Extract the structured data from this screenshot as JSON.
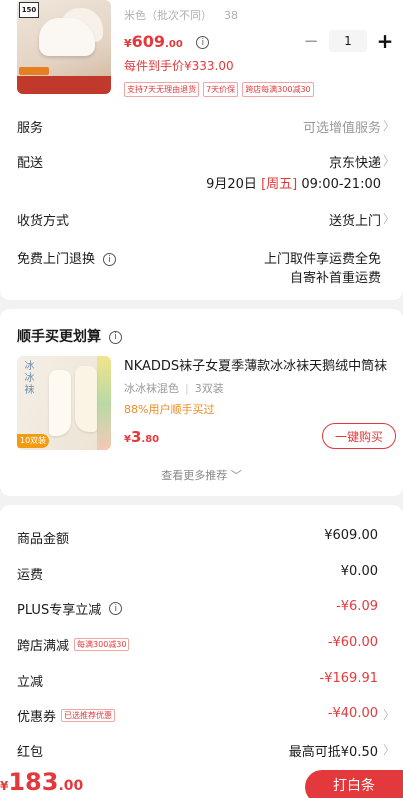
{
  "product": {
    "variant": "米色（批次不同）",
    "size": "38",
    "price_symbol": "¥",
    "price_int": "609",
    "price_dec": ".00",
    "per_piece": "每件到手价¥333.00",
    "quantity": "1",
    "tags": [
      "支持7天无理由退货",
      "7天价保",
      "跨店每满300减30"
    ],
    "thumb_badge": "150"
  },
  "service": {
    "label": "服务",
    "value": "可选增值服务"
  },
  "delivery": {
    "label": "配送",
    "carrier": "京东快递",
    "date": "9月20日",
    "weekday": "[周五]",
    "time": "09:00-21:00"
  },
  "receive": {
    "label": "收货方式",
    "value": "送货上门"
  },
  "return": {
    "label": "免费上门退换",
    "line1": "上门取件享运费全免",
    "line2": "自寄补首重运费"
  },
  "addon": {
    "title": "顺手买更划算",
    "product_title": "NKADDS袜子女夏季薄款冰冰袜天鹅绒中筒袜",
    "variant": "冰冰袜混色",
    "pack": "3双装",
    "rate": "88%用户顺手买过",
    "price_symbol": "¥",
    "price_int": "3",
    "price_dec": ".80",
    "buy_label": "一键购买",
    "more_label": "查看更多推荐",
    "thumb_text": "冰冰袜",
    "thumb_pill": "10双装"
  },
  "summary": {
    "rows": [
      {
        "label": "商品金额",
        "value": "¥609.00"
      },
      {
        "label": "运费",
        "value": "¥0.00"
      },
      {
        "label": "PLUS专享立减",
        "value": "-¥6.09"
      },
      {
        "label": "跨店满减",
        "tag": "每满300减30",
        "value": "-¥60.00"
      },
      {
        "label": "立减",
        "value": "-¥169.91"
      },
      {
        "label": "优惠券",
        "tag": "已选推荐优惠",
        "value": "-¥40.00"
      },
      {
        "label": "红包",
        "value": "最高可抵¥0.50"
      }
    ]
  },
  "footer": {
    "total_symbol": "¥",
    "total_int": "183",
    "total_dec": ".00",
    "pay_label": "打白条"
  },
  "colors": {
    "accent": "#e4393c",
    "orange": "#f08a24"
  }
}
